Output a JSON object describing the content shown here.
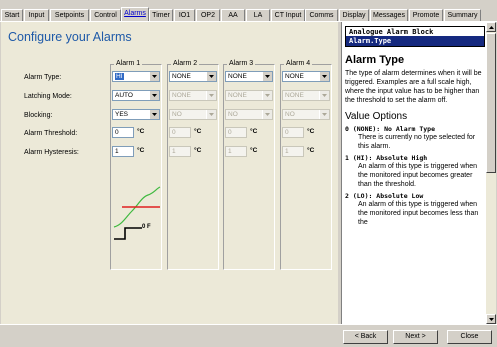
{
  "tabs": [
    {
      "label": "Start",
      "active": false
    },
    {
      "label": "Input",
      "active": false
    },
    {
      "label": "Setpoints",
      "active": false
    },
    {
      "label": "Control",
      "active": false
    },
    {
      "label": "Alarms",
      "active": true
    },
    {
      "label": "Timer",
      "active": false
    },
    {
      "label": "IO1",
      "active": false
    },
    {
      "label": "OP2",
      "active": false
    },
    {
      "label": "AA",
      "active": false
    },
    {
      "label": "LA",
      "active": false
    },
    {
      "label": "CT Input",
      "active": false
    },
    {
      "label": "Comms",
      "active": false
    },
    {
      "label": "Display",
      "active": false
    },
    {
      "label": "Messages",
      "active": false
    },
    {
      "label": "Promote",
      "active": false
    },
    {
      "label": "Summary",
      "active": false
    }
  ],
  "page": {
    "title": "Configure your Alarms"
  },
  "row_labels": {
    "alarm_type": "Alarm Type:",
    "latching_mode": "Latching Mode:",
    "blocking": "Blocking:",
    "alarm_threshold": "Alarm Threshold:",
    "alarm_hysteresis": "Alarm Hysteresis:"
  },
  "alarms": [
    {
      "title": "Alarm 1",
      "type": "HI",
      "latching": "AUTO",
      "blocking": "YES",
      "threshold": "0",
      "hysteresis": "1",
      "unit": "°C",
      "enabled": true
    },
    {
      "title": "Alarm 2",
      "type": "NONE",
      "latching": "NONE",
      "blocking": "NO",
      "threshold": "0",
      "hysteresis": "1",
      "unit": "°C",
      "enabled": false
    },
    {
      "title": "Alarm 3",
      "type": "NONE",
      "latching": "NONE",
      "blocking": "NO",
      "threshold": "0",
      "hysteresis": "1",
      "unit": "°C",
      "enabled": false
    },
    {
      "title": "Alarm 4",
      "type": "NONE",
      "latching": "NONE",
      "blocking": "NO",
      "threshold": "0",
      "hysteresis": "1",
      "unit": "°C",
      "enabled": false
    }
  ],
  "diagram": {
    "label": "0 F",
    "colors": {
      "curve": "#3fb93f",
      "threshold": "#e02020",
      "output": "#000000"
    }
  },
  "help": {
    "header_block": "Analogue Alarm Block",
    "header_param": "Alarm.Type",
    "title": "Alarm Type",
    "description": "The type of alarm determines when it will be triggered. Examples are a full scale high, where the input value has to be higher than the threshold to set the alarm off.",
    "options_heading": "Value Options",
    "options": [
      {
        "title": "0 (NONE): No Alarm Type",
        "desc": "There is currently no type selected for this alarm."
      },
      {
        "title": "1 (HI): Absolute High",
        "desc": "An alarm of this type is triggered when the monitored input becomes greater than the threshold."
      },
      {
        "title": "2 (LO): Absolute Low",
        "desc": "An alarm of this type is triggered when the monitored input becomes less than the"
      }
    ]
  },
  "buttons": {
    "back": "< Back",
    "next": "Next >",
    "close": "Close"
  },
  "colors": {
    "title": "#1f5aa8",
    "selection": "#316ac5",
    "help_highlight": "#15297f"
  }
}
